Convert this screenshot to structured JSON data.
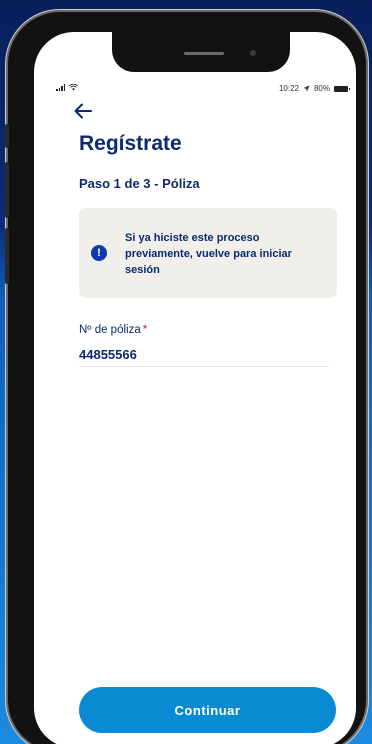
{
  "status_bar": {
    "time": "10:22",
    "location_icon": "location-arrow-icon",
    "battery_percent": "80%"
  },
  "header": {
    "back_icon": "arrow-left-icon",
    "title": "Regístrate",
    "step": "Paso 1 de 3 - Póliza"
  },
  "info_banner": {
    "icon": "exclamation-circle-icon",
    "text": "Si ya hiciste este proceso previamente, vuelve para iniciar sesión"
  },
  "form": {
    "policy_label": "Nº de póliza",
    "required_mark": "*",
    "policy_value": "44855566"
  },
  "actions": {
    "continue_label": "Continuar"
  },
  "colors": {
    "primary_text": "#0b2a6f",
    "button": "#0b8ad4",
    "info_bg": "#f1efec",
    "info_icon": "#0d3aa8",
    "required": "#c8102e"
  }
}
